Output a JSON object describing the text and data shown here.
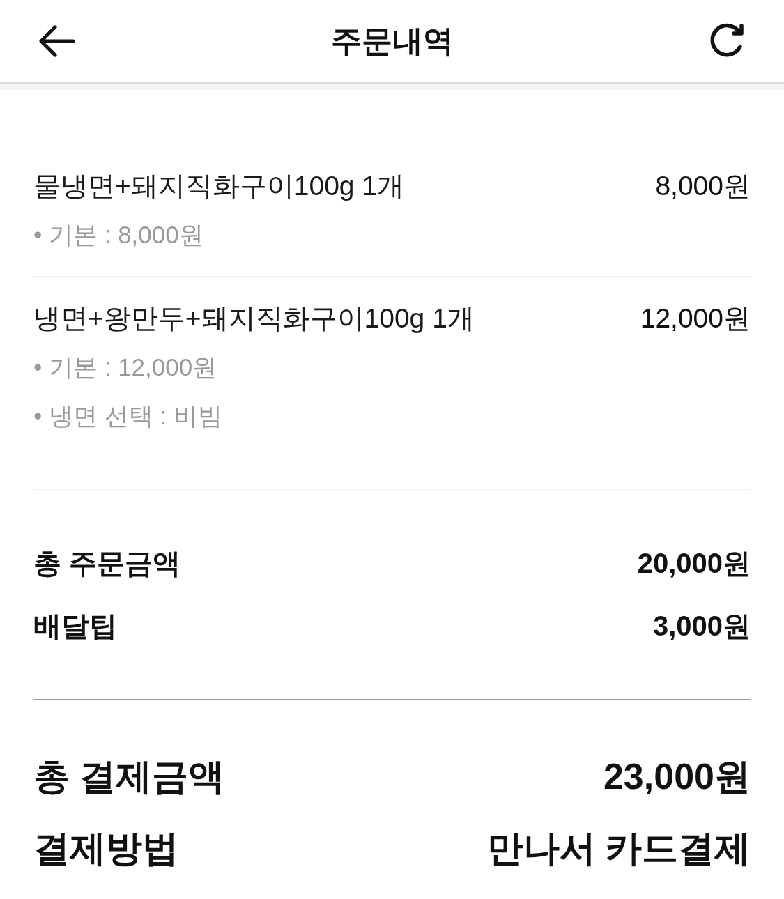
{
  "header": {
    "title": "주문내역"
  },
  "items": [
    {
      "name": "물냉면+돼지직화구이100g 1개",
      "price": "8,000원",
      "options": [
        "• 기본 : 8,000원"
      ]
    },
    {
      "name": "냉면+왕만두+돼지직화구이100g 1개",
      "price": "12,000원",
      "options": [
        "• 기본 : 12,000원",
        "• 냉면 선택 : 비빔"
      ]
    }
  ],
  "summary": [
    {
      "label": "총 주문금액",
      "value": "20,000원"
    },
    {
      "label": "배달팁",
      "value": "3,000원"
    }
  ],
  "payment": [
    {
      "label": "총 결제금액",
      "value": "23,000원"
    },
    {
      "label": "결제방법",
      "value": "만나서 카드결제"
    }
  ]
}
